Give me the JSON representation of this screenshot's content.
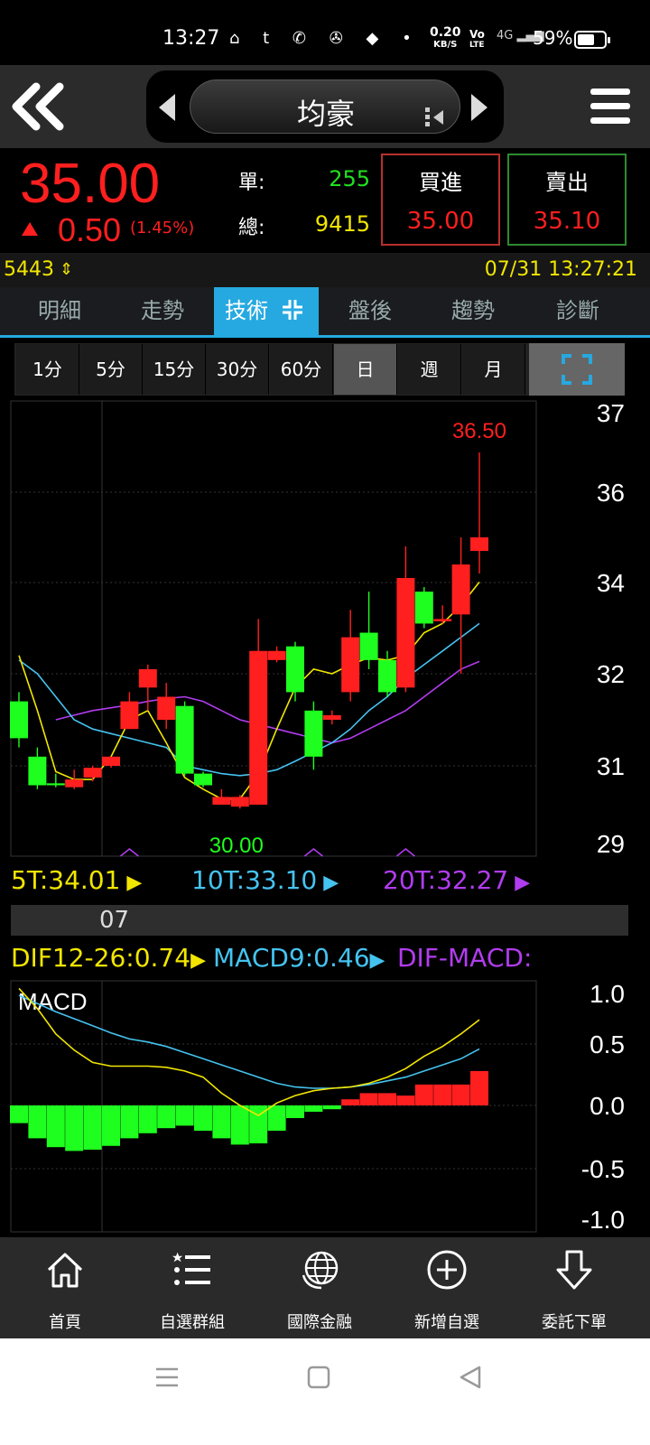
{
  "status": {
    "time": "13:27",
    "netspeed_value": "0.20",
    "netspeed_unit": "KB/S",
    "volte_top": "Vo",
    "volte_bottom": "LTE",
    "network": "4G",
    "battery": "59%"
  },
  "header": {
    "stock_name": "均豪"
  },
  "quote": {
    "last_price": "35.00",
    "change": "0.50",
    "change_pct": "(1.45%)",
    "single_label": "單:",
    "single_volume": "255",
    "total_label": "總:",
    "total_volume": "9415",
    "buy_label": "買進",
    "buy_price": "35.00",
    "sell_label": "賣出",
    "sell_price": "35.10"
  },
  "info": {
    "stock_code": "5443",
    "datetime": "07/31 13:27:21"
  },
  "tabs": [
    "明細",
    "走勢",
    "技術",
    "盤後",
    "趨勢",
    "診斷"
  ],
  "active_tab": "技術",
  "intervals": [
    "1分",
    "5分",
    "15分",
    "30分",
    "60分",
    "日",
    "週",
    "月"
  ],
  "active_interval": "日",
  "colors": {
    "up": "#ff1f1f",
    "down": "#1fff1f",
    "ma5": "#f2e600",
    "ma10": "#45c3f0",
    "ma20": "#b23cf0",
    "accent": "#26a9e0"
  },
  "ma_legend": {
    "ma5": "5T:34.01",
    "ma10": "10T:33.10",
    "ma20": "20T:32.27"
  },
  "date_label": "07",
  "macd_legend": {
    "dif": "DIF12-26:0.74",
    "macd": "MACD9:0.46",
    "osc": "DIF-MACD:"
  },
  "chart_data": [
    {
      "type": "candlestick",
      "y_ticks": [
        "37",
        "36",
        "34",
        "32",
        "31",
        "29"
      ],
      "high_label": "36.50",
      "low_label": "30.00",
      "candles": [
        {
          "o": 31.7,
          "c": 31.3,
          "h": 31.8,
          "l": 31.2
        },
        {
          "o": 31.1,
          "c": 30.5,
          "h": 31.2,
          "l": 30.4
        },
        {
          "o": 30.55,
          "c": 30.5,
          "h": 30.8,
          "l": 30.45
        },
        {
          "o": 30.45,
          "c": 30.65,
          "h": 30.9,
          "l": 30.4
        },
        {
          "o": 30.7,
          "c": 30.95,
          "h": 31.0,
          "l": 30.6
        },
        {
          "o": 31.0,
          "c": 31.1,
          "h": 31.1,
          "l": 30.95
        },
        {
          "o": 31.4,
          "c": 31.7,
          "h": 31.8,
          "l": 31.4
        },
        {
          "o": 31.85,
          "c": 32.1,
          "h": 32.2,
          "l": 31.6
        },
        {
          "o": 31.5,
          "c": 31.75,
          "h": 31.9,
          "l": 31.4
        },
        {
          "o": 31.65,
          "c": 30.8,
          "h": 31.7,
          "l": 30.75
        },
        {
          "o": 30.8,
          "c": 30.5,
          "h": 30.85,
          "l": 30.45
        },
        {
          "o": 30.0,
          "c": 30.2,
          "h": 30.4,
          "l": 30.0
        },
        {
          "o": 29.95,
          "c": 30.2,
          "h": 30.25,
          "l": 29.9
        },
        {
          "o": 30.0,
          "c": 32.5,
          "h": 33.2,
          "l": 30.0
        },
        {
          "o": 32.3,
          "c": 32.5,
          "h": 32.6,
          "l": 32.25
        },
        {
          "o": 32.6,
          "c": 31.8,
          "h": 32.7,
          "l": 31.7
        },
        {
          "o": 31.6,
          "c": 31.1,
          "h": 31.7,
          "l": 30.9
        },
        {
          "o": 31.5,
          "c": 31.55,
          "h": 31.6,
          "l": 31.45
        },
        {
          "o": 31.8,
          "c": 32.8,
          "h": 33.4,
          "l": 31.7
        },
        {
          "o": 32.9,
          "c": 32.3,
          "h": 33.8,
          "l": 32.1
        },
        {
          "o": 32.3,
          "c": 31.8,
          "h": 32.5,
          "l": 31.75
        },
        {
          "o": 31.85,
          "c": 34.1,
          "h": 34.8,
          "l": 31.8
        },
        {
          "o": 33.8,
          "c": 33.1,
          "h": 33.9,
          "l": 33.0
        },
        {
          "o": 33.15,
          "c": 33.2,
          "h": 33.5,
          "l": 33.1
        },
        {
          "o": 33.3,
          "c": 34.4,
          "h": 35.0,
          "l": 32.0
        },
        {
          "o": 34.7,
          "c": 35.0,
          "h": 36.5,
          "l": 34.2
        }
      ],
      "ma5": [
        32.4,
        31.6,
        30.85,
        30.65,
        30.65,
        31.1,
        31.5,
        31.6,
        31.25,
        30.7,
        30.4,
        30.15,
        30.15,
        30.8,
        31.4,
        31.85,
        32.1,
        32.0,
        32.2,
        32.35,
        32.3,
        32.4,
        32.9,
        33.1,
        33.5,
        34.01
      ],
      "ma10": [
        32.3,
        32.0,
        31.75,
        31.5,
        31.4,
        31.35,
        31.3,
        31.25,
        31.2,
        31.0,
        30.9,
        30.8,
        30.75,
        30.8,
        30.9,
        31.05,
        31.15,
        31.25,
        31.4,
        31.6,
        31.75,
        31.95,
        32.2,
        32.5,
        32.8,
        33.1
      ],
      "ma20": [
        null,
        null,
        31.5,
        31.55,
        31.6,
        31.63,
        31.66,
        31.7,
        31.73,
        31.75,
        31.7,
        31.6,
        31.5,
        31.45,
        31.4,
        31.35,
        31.3,
        31.25,
        31.3,
        31.4,
        31.5,
        31.6,
        31.75,
        31.9,
        32.1,
        32.27
      ]
    },
    {
      "type": "macd",
      "title": "MACD",
      "y_ticks": [
        "1.0",
        "0.5",
        "0.0",
        "-0.5",
        "-1.0"
      ],
      "dif": [
        1.05,
        0.85,
        0.6,
        0.45,
        0.35,
        0.32,
        0.32,
        0.32,
        0.31,
        0.28,
        0.23,
        0.1,
        0.0,
        -0.08,
        0.02,
        0.08,
        0.12,
        0.14,
        0.15,
        0.18,
        0.23,
        0.3,
        0.4,
        0.48,
        0.6,
        0.74
      ],
      "macd": [
        0.98,
        0.9,
        0.82,
        0.75,
        0.68,
        0.61,
        0.55,
        0.52,
        0.48,
        0.43,
        0.38,
        0.33,
        0.28,
        0.23,
        0.18,
        0.15,
        0.14,
        0.14,
        0.15,
        0.17,
        0.2,
        0.23,
        0.28,
        0.33,
        0.38,
        0.46
      ],
      "osc": [
        -0.14,
        -0.26,
        -0.33,
        -0.36,
        -0.35,
        -0.32,
        -0.26,
        -0.22,
        -0.18,
        -0.16,
        -0.2,
        -0.26,
        -0.31,
        -0.3,
        -0.2,
        -0.1,
        -0.05,
        -0.03,
        0.05,
        0.1,
        0.1,
        0.08,
        0.17,
        0.17,
        0.17,
        0.28
      ]
    }
  ],
  "bottom_nav": [
    {
      "label": "首頁",
      "icon": "home-icon"
    },
    {
      "label": "自選群組",
      "icon": "list-icon"
    },
    {
      "label": "國際金融",
      "icon": "globe-icon"
    },
    {
      "label": "新增自選",
      "icon": "plus-circle-icon"
    },
    {
      "label": "委託下單",
      "icon": "order-down-icon"
    }
  ]
}
